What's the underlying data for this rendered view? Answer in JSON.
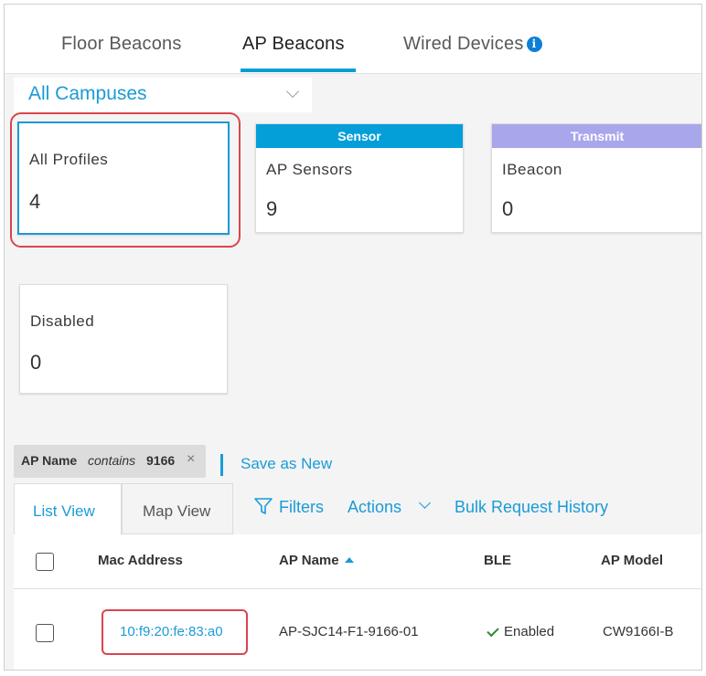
{
  "top_tabs": [
    {
      "label": "Floor Beacons",
      "active": false
    },
    {
      "label": "AP Beacons",
      "active": true
    },
    {
      "label": "Wired Devices",
      "active": false
    }
  ],
  "campus_select": {
    "value": "All Campuses"
  },
  "profile_cards": {
    "all_profiles": {
      "label": "All Profiles",
      "value": "4"
    },
    "ap_sensors": {
      "header": "Sensor",
      "label": "AP Sensors",
      "value": "9",
      "header_color": "#049fd9"
    },
    "ibeacon": {
      "header": "Transmit",
      "label": "IBeacon",
      "value": "0",
      "header_color": "#a9a7ec"
    },
    "disabled": {
      "label": "Disabled",
      "value": "0"
    }
  },
  "filter_chip": {
    "field": "AP Name",
    "operator": "contains",
    "value": "9166",
    "remove": "×"
  },
  "save_as_new": "Save as New",
  "view_tabs": [
    {
      "label": "List View",
      "active": true
    },
    {
      "label": "Map View",
      "active": false
    }
  ],
  "toolbar": {
    "filters": "Filters",
    "actions": "Actions",
    "bulk_history": "Bulk Request History"
  },
  "table": {
    "columns": [
      "Mac Address",
      "AP Name",
      "BLE",
      "AP Model"
    ],
    "sort": {
      "column": "AP Name",
      "direction": "ascending"
    },
    "rows": [
      {
        "mac": "10:f9:20:fe:83:a0",
        "ap_name": "AP-SJC14-F1-9166-01",
        "ble": "Enabled",
        "model": "CW9166I-B"
      }
    ]
  },
  "colors": {
    "accent": "#1a9bd7",
    "highlight": "#d9454f",
    "enabled": "#2e8b2e"
  }
}
